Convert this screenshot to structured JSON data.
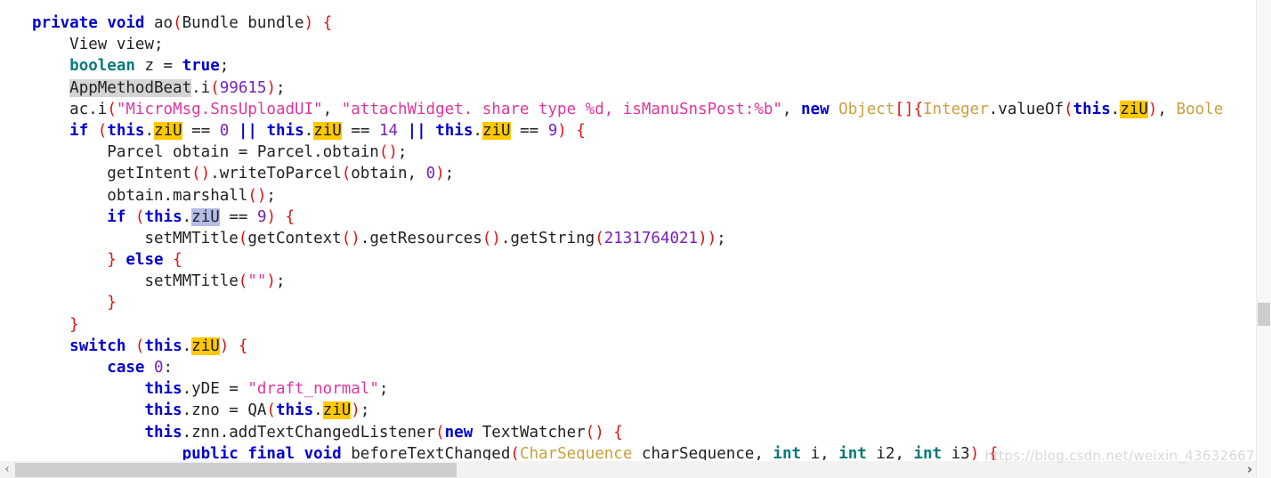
{
  "editor": {
    "language": "java",
    "colors": {
      "background": "#ffffff",
      "keyword": "#0000d0",
      "string": "#e0369c",
      "number": "#7722c0",
      "type": "#c8a03c",
      "primitive": "#0a7a7a",
      "delimiter": "#e01010",
      "plain": "#222222",
      "highlight_find": "#ffc800",
      "highlight_selection": "#b4bce8",
      "highlight_occurrence": "#d4d4d4",
      "scrollbar_track": "#f2f2f2",
      "scrollbar_thumb": "#cdcdcd"
    },
    "code_lines": [
      {
        "indent": 1,
        "tokens": [
          {
            "text": "private",
            "cls": "t-kw"
          },
          {
            "text": " ",
            "cls": "t-plain"
          },
          {
            "text": "void",
            "cls": "t-kw"
          },
          {
            "text": " ao",
            "cls": "t-plain"
          },
          {
            "text": "(",
            "cls": "t-paren"
          },
          {
            "text": "Bundle bundle",
            "cls": "t-plain"
          },
          {
            "text": ")",
            "cls": "t-paren"
          },
          {
            "text": " ",
            "cls": "t-plain"
          },
          {
            "text": "{",
            "cls": "t-paren"
          }
        ]
      },
      {
        "indent": 2,
        "tokens": [
          {
            "text": "View view;",
            "cls": "t-plain"
          }
        ]
      },
      {
        "indent": 2,
        "tokens": [
          {
            "text": "boolean",
            "cls": "t-prim"
          },
          {
            "text": " z = ",
            "cls": "t-plain"
          },
          {
            "text": "true",
            "cls": "t-kw"
          },
          {
            "text": ";",
            "cls": "t-plain"
          }
        ]
      },
      {
        "indent": 2,
        "tokens": [
          {
            "text": "AppMethodBeat",
            "cls": "t-plain hl-gray"
          },
          {
            "text": ".i",
            "cls": "t-plain"
          },
          {
            "text": "(",
            "cls": "t-paren"
          },
          {
            "text": "99615",
            "cls": "t-num"
          },
          {
            "text": ")",
            "cls": "t-paren"
          },
          {
            "text": ";",
            "cls": "t-plain"
          }
        ]
      },
      {
        "indent": 2,
        "tokens": [
          {
            "text": "ac.i",
            "cls": "t-plain"
          },
          {
            "text": "(",
            "cls": "t-paren"
          },
          {
            "text": "\"MicroMsg.SnsUploadUI\"",
            "cls": "t-str"
          },
          {
            "text": ", ",
            "cls": "t-plain"
          },
          {
            "text": "\"attachWidget. share type %d, isManuSnsPost:%b\"",
            "cls": "t-str"
          },
          {
            "text": ", ",
            "cls": "t-plain"
          },
          {
            "text": "new",
            "cls": "t-kw"
          },
          {
            "text": " ",
            "cls": "t-plain"
          },
          {
            "text": "Object",
            "cls": "t-type"
          },
          {
            "text": "[]",
            "cls": "t-paren"
          },
          {
            "text": "{",
            "cls": "t-paren"
          },
          {
            "text": "Integer",
            "cls": "t-type"
          },
          {
            "text": ".valueOf",
            "cls": "t-plain"
          },
          {
            "text": "(",
            "cls": "t-paren"
          },
          {
            "text": "this",
            "cls": "t-kw"
          },
          {
            "text": ".",
            "cls": "t-plain"
          },
          {
            "text": "ziU",
            "cls": "t-plain hl-find"
          },
          {
            "text": ")",
            "cls": "t-paren"
          },
          {
            "text": ", ",
            "cls": "t-plain"
          },
          {
            "text": "Boole",
            "cls": "t-type"
          }
        ]
      },
      {
        "indent": 2,
        "tokens": [
          {
            "text": "if",
            "cls": "t-kw"
          },
          {
            "text": " ",
            "cls": "t-plain"
          },
          {
            "text": "(",
            "cls": "t-paren"
          },
          {
            "text": "this",
            "cls": "t-kw"
          },
          {
            "text": ".",
            "cls": "t-plain"
          },
          {
            "text": "ziU",
            "cls": "t-plain hl-find"
          },
          {
            "text": " == ",
            "cls": "t-plain"
          },
          {
            "text": "0",
            "cls": "t-num"
          },
          {
            "text": " ",
            "cls": "t-plain"
          },
          {
            "text": "||",
            "cls": "t-kw"
          },
          {
            "text": " ",
            "cls": "t-plain"
          },
          {
            "text": "this",
            "cls": "t-kw"
          },
          {
            "text": ".",
            "cls": "t-plain"
          },
          {
            "text": "ziU",
            "cls": "t-plain hl-find"
          },
          {
            "text": " == ",
            "cls": "t-plain"
          },
          {
            "text": "14",
            "cls": "t-num"
          },
          {
            "text": " ",
            "cls": "t-plain"
          },
          {
            "text": "||",
            "cls": "t-kw"
          },
          {
            "text": " ",
            "cls": "t-plain"
          },
          {
            "text": "this",
            "cls": "t-kw"
          },
          {
            "text": ".",
            "cls": "t-plain"
          },
          {
            "text": "ziU",
            "cls": "t-plain hl-find"
          },
          {
            "text": " == ",
            "cls": "t-plain"
          },
          {
            "text": "9",
            "cls": "t-num"
          },
          {
            "text": ")",
            "cls": "t-paren"
          },
          {
            "text": " ",
            "cls": "t-plain"
          },
          {
            "text": "{",
            "cls": "t-paren"
          }
        ]
      },
      {
        "indent": 3,
        "tokens": [
          {
            "text": "Parcel obtain = Parcel.obtain",
            "cls": "t-plain"
          },
          {
            "text": "()",
            "cls": "t-paren"
          },
          {
            "text": ";",
            "cls": "t-plain"
          }
        ]
      },
      {
        "indent": 3,
        "tokens": [
          {
            "text": "getIntent",
            "cls": "t-plain"
          },
          {
            "text": "()",
            "cls": "t-paren"
          },
          {
            "text": ".writeToParcel",
            "cls": "t-plain"
          },
          {
            "text": "(",
            "cls": "t-paren"
          },
          {
            "text": "obtain, ",
            "cls": "t-plain"
          },
          {
            "text": "0",
            "cls": "t-num"
          },
          {
            "text": ")",
            "cls": "t-paren"
          },
          {
            "text": ";",
            "cls": "t-plain"
          }
        ]
      },
      {
        "indent": 3,
        "tokens": [
          {
            "text": "obtain.marshall",
            "cls": "t-plain"
          },
          {
            "text": "()",
            "cls": "t-paren"
          },
          {
            "text": ";",
            "cls": "t-plain"
          }
        ]
      },
      {
        "indent": 3,
        "tokens": [
          {
            "text": "if",
            "cls": "t-kw"
          },
          {
            "text": " ",
            "cls": "t-plain"
          },
          {
            "text": "(",
            "cls": "t-paren"
          },
          {
            "text": "this",
            "cls": "t-kw"
          },
          {
            "text": ".",
            "cls": "t-plain"
          },
          {
            "text": "ziU",
            "cls": "t-plain hl-sel"
          },
          {
            "text": " == ",
            "cls": "t-plain"
          },
          {
            "text": "9",
            "cls": "t-num"
          },
          {
            "text": ")",
            "cls": "t-paren"
          },
          {
            "text": " ",
            "cls": "t-plain"
          },
          {
            "text": "{",
            "cls": "t-paren"
          }
        ]
      },
      {
        "indent": 4,
        "tokens": [
          {
            "text": "setMMTitle",
            "cls": "t-plain"
          },
          {
            "text": "(",
            "cls": "t-paren"
          },
          {
            "text": "getContext",
            "cls": "t-plain"
          },
          {
            "text": "()",
            "cls": "t-paren"
          },
          {
            "text": ".getResources",
            "cls": "t-plain"
          },
          {
            "text": "()",
            "cls": "t-paren"
          },
          {
            "text": ".getString",
            "cls": "t-plain"
          },
          {
            "text": "(",
            "cls": "t-paren"
          },
          {
            "text": "2131764021",
            "cls": "t-num"
          },
          {
            "text": "))",
            "cls": "t-paren"
          },
          {
            "text": ";",
            "cls": "t-plain"
          }
        ]
      },
      {
        "indent": 3,
        "tokens": [
          {
            "text": "}",
            "cls": "t-paren"
          },
          {
            "text": " ",
            "cls": "t-plain"
          },
          {
            "text": "else",
            "cls": "t-kw"
          },
          {
            "text": " ",
            "cls": "t-plain"
          },
          {
            "text": "{",
            "cls": "t-paren"
          }
        ]
      },
      {
        "indent": 4,
        "tokens": [
          {
            "text": "setMMTitle",
            "cls": "t-plain"
          },
          {
            "text": "(",
            "cls": "t-paren"
          },
          {
            "text": "\"\"",
            "cls": "t-str"
          },
          {
            "text": ")",
            "cls": "t-paren"
          },
          {
            "text": ";",
            "cls": "t-plain"
          }
        ]
      },
      {
        "indent": 3,
        "tokens": [
          {
            "text": "}",
            "cls": "t-paren"
          }
        ]
      },
      {
        "indent": 2,
        "tokens": [
          {
            "text": "}",
            "cls": "t-paren"
          }
        ]
      },
      {
        "indent": 2,
        "tokens": [
          {
            "text": "switch",
            "cls": "t-kw"
          },
          {
            "text": " ",
            "cls": "t-plain"
          },
          {
            "text": "(",
            "cls": "t-paren"
          },
          {
            "text": "this",
            "cls": "t-kw"
          },
          {
            "text": ".",
            "cls": "t-plain"
          },
          {
            "text": "ziU",
            "cls": "t-plain hl-find"
          },
          {
            "text": ")",
            "cls": "t-paren"
          },
          {
            "text": " ",
            "cls": "t-plain"
          },
          {
            "text": "{",
            "cls": "t-paren"
          }
        ]
      },
      {
        "indent": 3,
        "tokens": [
          {
            "text": "case",
            "cls": "t-kw"
          },
          {
            "text": " ",
            "cls": "t-plain"
          },
          {
            "text": "0",
            "cls": "t-num"
          },
          {
            "text": ":",
            "cls": "t-plain"
          }
        ]
      },
      {
        "indent": 4,
        "tokens": [
          {
            "text": "this",
            "cls": "t-kw"
          },
          {
            "text": ".yDE = ",
            "cls": "t-plain"
          },
          {
            "text": "\"draft_normal\"",
            "cls": "t-str"
          },
          {
            "text": ";",
            "cls": "t-plain"
          }
        ]
      },
      {
        "indent": 4,
        "tokens": [
          {
            "text": "this",
            "cls": "t-kw"
          },
          {
            "text": ".zno = QA",
            "cls": "t-plain"
          },
          {
            "text": "(",
            "cls": "t-paren"
          },
          {
            "text": "this",
            "cls": "t-kw"
          },
          {
            "text": ".",
            "cls": "t-plain"
          },
          {
            "text": "ziU",
            "cls": "t-plain hl-find"
          },
          {
            "text": ")",
            "cls": "t-paren"
          },
          {
            "text": ";",
            "cls": "t-plain"
          }
        ]
      },
      {
        "indent": 4,
        "tokens": [
          {
            "text": "this",
            "cls": "t-kw"
          },
          {
            "text": ".znn.addTextChangedListener",
            "cls": "t-plain"
          },
          {
            "text": "(",
            "cls": "t-paren"
          },
          {
            "text": "new",
            "cls": "t-kw"
          },
          {
            "text": " TextWatcher",
            "cls": "t-plain"
          },
          {
            "text": "()",
            "cls": "t-paren"
          },
          {
            "text": " ",
            "cls": "t-plain"
          },
          {
            "text": "{",
            "cls": "t-paren"
          }
        ]
      },
      {
        "indent": 5,
        "tokens": [
          {
            "text": "public",
            "cls": "t-kw"
          },
          {
            "text": " ",
            "cls": "t-plain"
          },
          {
            "text": "final",
            "cls": "t-kw"
          },
          {
            "text": " ",
            "cls": "t-plain"
          },
          {
            "text": "void",
            "cls": "t-kw"
          },
          {
            "text": " beforeTextChanged",
            "cls": "t-plain"
          },
          {
            "text": "(",
            "cls": "t-paren"
          },
          {
            "text": "CharSequence",
            "cls": "t-type"
          },
          {
            "text": " charSequence, ",
            "cls": "t-plain"
          },
          {
            "text": "int",
            "cls": "t-prim"
          },
          {
            "text": " i, ",
            "cls": "t-plain"
          },
          {
            "text": "int",
            "cls": "t-prim"
          },
          {
            "text": " i2, ",
            "cls": "t-plain"
          },
          {
            "text": "int",
            "cls": "t-prim"
          },
          {
            "text": " i3",
            "cls": "t-plain"
          },
          {
            "text": ")",
            "cls": "t-paren"
          },
          {
            "text": " ",
            "cls": "t-plain"
          },
          {
            "text": "{",
            "cls": "t-paren"
          }
        ]
      }
    ]
  },
  "scrollbars": {
    "horizontal": {
      "left_arrow_glyph": "‹",
      "right_arrow_glyph": "›",
      "thumb_position_pct": 1,
      "thumb_width_pct": 35
    },
    "vertical": {
      "thumb_position_pct": 63,
      "thumb_height_pct": 5
    }
  },
  "watermark": {
    "text": "https://blog.csdn.net/weixin_43632667"
  }
}
